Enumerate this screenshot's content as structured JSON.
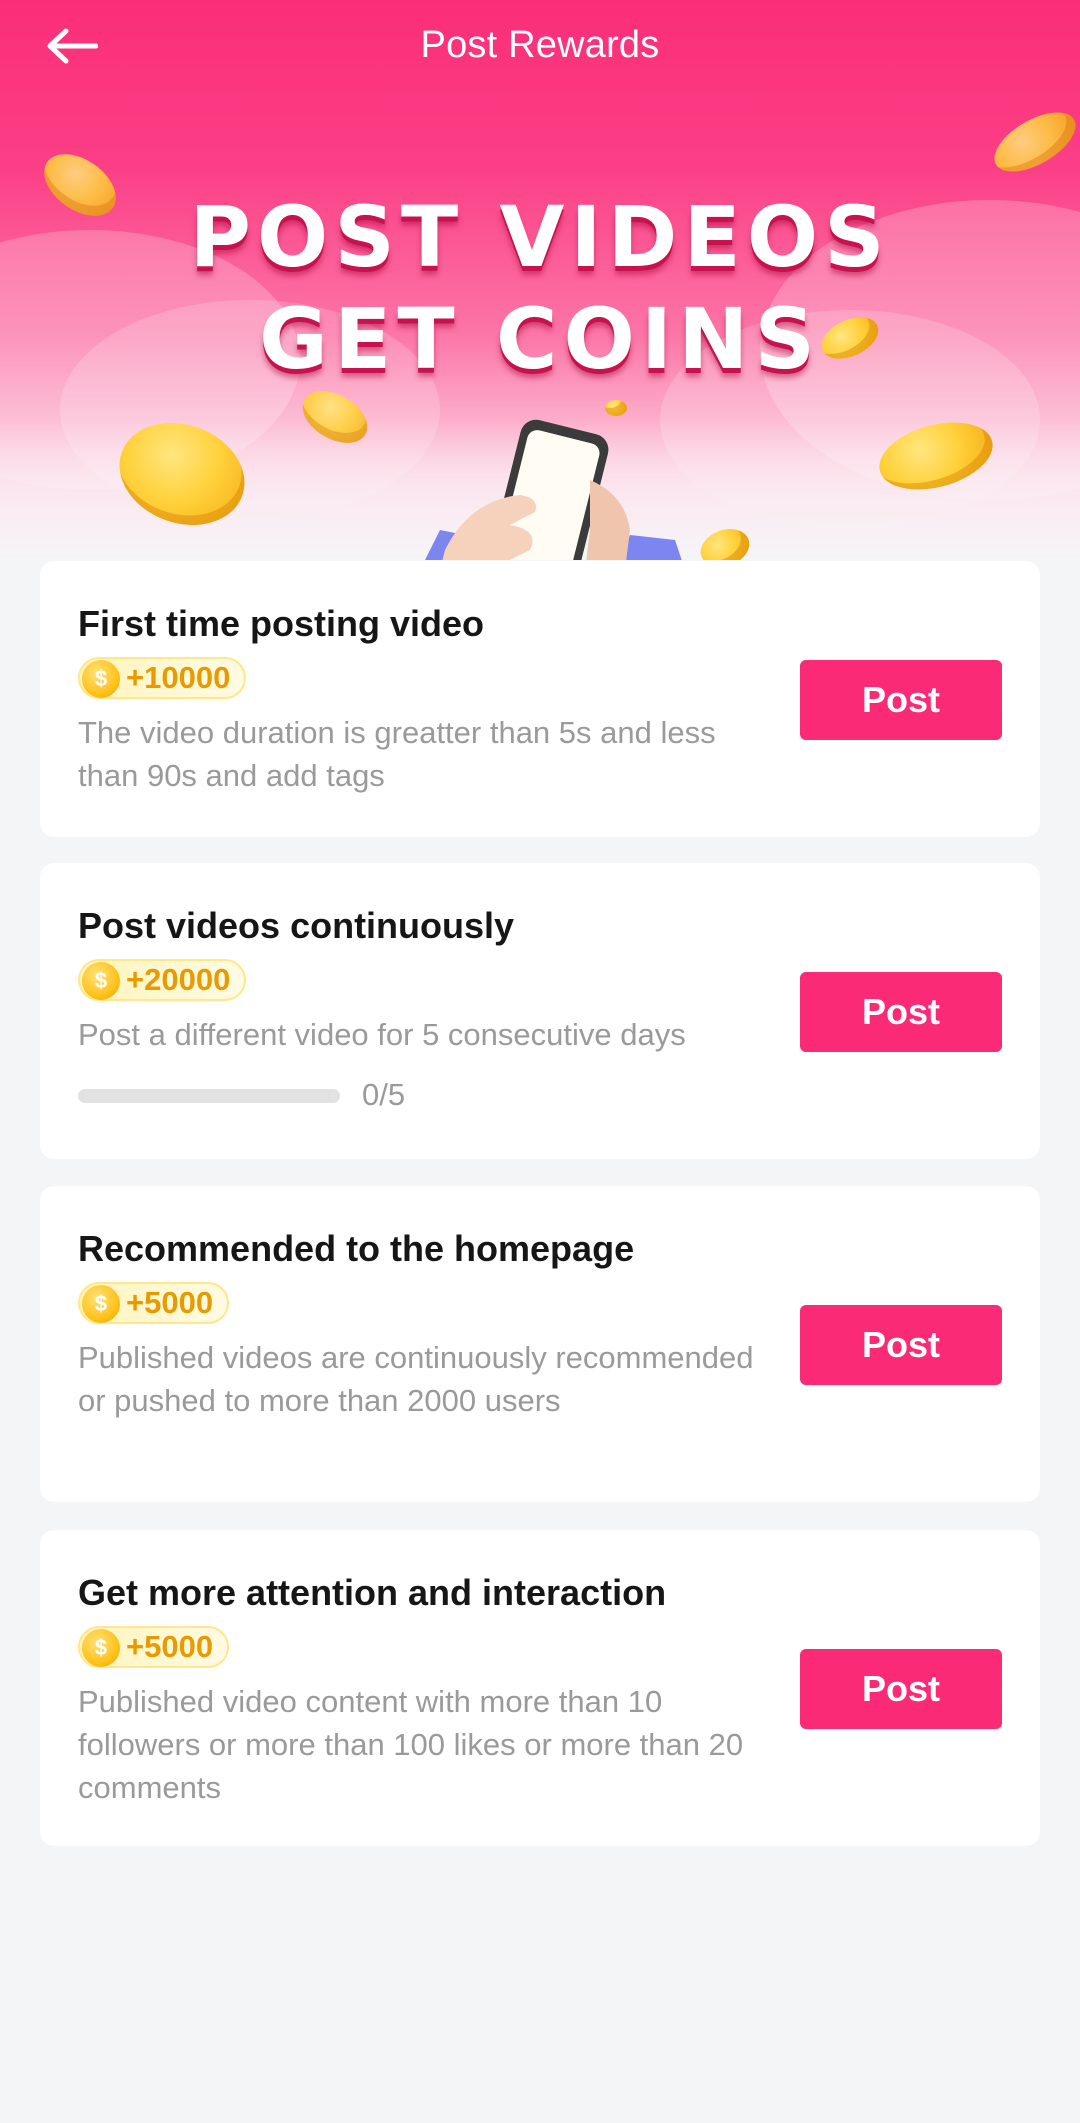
{
  "header": {
    "title": "Post Rewards"
  },
  "banner": {
    "line1": "POST VIDEOS",
    "line2": "GET COINS"
  },
  "colors": {
    "brand": "#fb2a76",
    "reward_text": "#e89b00",
    "muted_text": "#9a9a9a",
    "page_background": "#f4f5f7"
  },
  "coin_symbol": "$",
  "tasks": [
    {
      "title": "First time posting video",
      "reward": "+10000",
      "description": "The video duration is greatter than 5s and less than 90s and add tags",
      "button": "Post"
    },
    {
      "title": "Post videos continuously",
      "reward": "+20000",
      "description": "Post a different video for 5 consecutive days",
      "button": "Post",
      "progress": {
        "current": 0,
        "total": 5,
        "label": "0/5"
      }
    },
    {
      "title": "Recommended to the homepage",
      "reward": "+5000",
      "description": "Published videos are continuously recommended or pushed to more than 2000 users",
      "button": "Post"
    },
    {
      "title": "Get more attention and interaction",
      "reward": "+5000",
      "description": "Published video content with more than 10 followers or more than 100 likes or more than 20 comments",
      "button": "Post"
    }
  ]
}
